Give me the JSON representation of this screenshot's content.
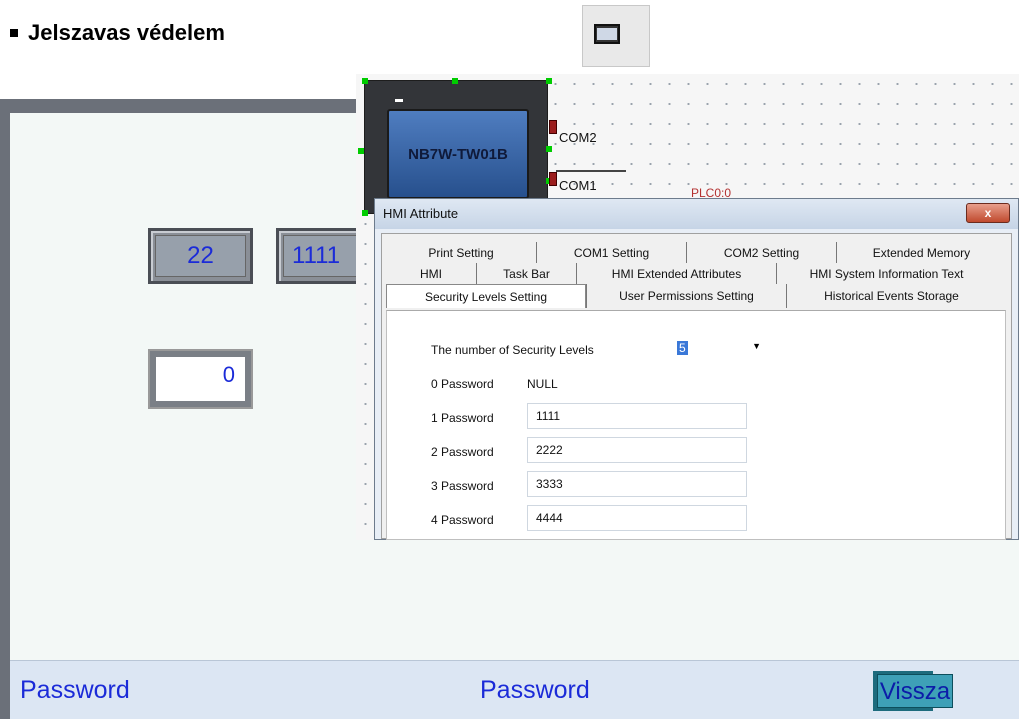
{
  "slide": {
    "bullet_text": "Jelszavas védelem"
  },
  "hmi_screen": {
    "button_1": "22",
    "button_2": "1111",
    "display_value": "0",
    "status_left": "Password",
    "status_center": "Password",
    "back_button": "Vissza"
  },
  "editor": {
    "device_name": "NB7W-TW01B",
    "com2_label": "COM2",
    "com1_label": "COM1",
    "plc_label": "PLC0:0"
  },
  "dialog": {
    "title": "HMI Attribute",
    "close_label": "x",
    "tabs_row1": [
      "Print Setting",
      "COM1 Setting",
      "COM2 Setting",
      "Extended Memory"
    ],
    "tabs_row2": [
      "HMI",
      "Task Bar",
      "HMI Extended Attributes",
      "HMI System Information Text"
    ],
    "tabs_row3": [
      "Security Levels Setting",
      "User Permissions Setting",
      "Historical Events Storage"
    ],
    "active_tab": "Security Levels Setting",
    "security_levels_label": "The number of Security Levels",
    "security_levels_value": "5",
    "passwords": [
      {
        "label": "0 Password",
        "value": "NULL"
      },
      {
        "label": "1 Password",
        "value": "1111"
      },
      {
        "label": "2 Password",
        "value": "2222"
      },
      {
        "label": "3 Password",
        "value": "3333"
      },
      {
        "label": "4 Password",
        "value": "4444"
      }
    ]
  },
  "colors": {
    "hmi_text": "#1b2bd8",
    "status_bar": "#dce6f3",
    "back_button": "#3ea0b7"
  }
}
